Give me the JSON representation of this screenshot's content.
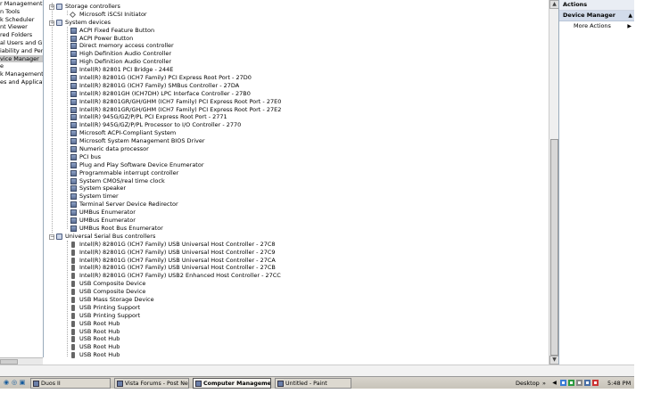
{
  "left_pane": {
    "items": [
      {
        "label": "r Management (L",
        "selected": false
      },
      {
        "label": "n Tools",
        "selected": false
      },
      {
        "label": "k Scheduler",
        "selected": false
      },
      {
        "label": "nt Viewer",
        "selected": false
      },
      {
        "label": "red Folders",
        "selected": false
      },
      {
        "label": "al Users and Gr",
        "selected": false
      },
      {
        "label": "iability and Perfc",
        "selected": false
      },
      {
        "label": "vice Manager",
        "selected": true
      },
      {
        "label": "e",
        "selected": false
      },
      {
        "label": "k Management",
        "selected": false
      },
      {
        "label": "es and Applicatio",
        "selected": false
      }
    ]
  },
  "tree": {
    "rows": [
      {
        "label": "Storage controllers",
        "level": 0,
        "kind": "category",
        "icon": "storage-controller-icon",
        "expanded": true
      },
      {
        "label": "Microsoft iSCSI Initiator",
        "level": 1,
        "kind": "device",
        "icon": "iscsi-icon"
      },
      {
        "label": "System devices",
        "level": 0,
        "kind": "category",
        "icon": "system-devices-icon",
        "expanded": true
      },
      {
        "label": "ACPI Fixed Feature Button",
        "level": 1,
        "kind": "device",
        "icon": "system-device-icon"
      },
      {
        "label": "ACPI Power Button",
        "level": 1,
        "kind": "device",
        "icon": "system-device-icon"
      },
      {
        "label": "Direct memory access controller",
        "level": 1,
        "kind": "device",
        "icon": "system-device-icon"
      },
      {
        "label": "High Definition Audio Controller",
        "level": 1,
        "kind": "device",
        "icon": "system-device-icon"
      },
      {
        "label": "High Definition Audio Controller",
        "level": 1,
        "kind": "device",
        "icon": "system-device-icon"
      },
      {
        "label": "Intel(R) 82801 PCI Bridge - 244E",
        "level": 1,
        "kind": "device",
        "icon": "system-device-icon"
      },
      {
        "label": "Intel(R) 82801G (ICH7 Family) PCI Express Root Port - 27D0",
        "level": 1,
        "kind": "device",
        "icon": "system-device-icon"
      },
      {
        "label": "Intel(R) 82801G (ICH7 Family) SMBus Controller - 27DA",
        "level": 1,
        "kind": "device",
        "icon": "system-device-icon"
      },
      {
        "label": "Intel(R) 82801GH (ICH7DH) LPC Interface Controller - 27B0",
        "level": 1,
        "kind": "device",
        "icon": "system-device-icon"
      },
      {
        "label": "Intel(R) 82801GR/GH/GHM (ICH7 Family) PCI Express Root Port - 27E0",
        "level": 1,
        "kind": "device",
        "icon": "system-device-icon"
      },
      {
        "label": "Intel(R) 82801GR/GH/GHM (ICH7 Family) PCI Express Root Port - 27E2",
        "level": 1,
        "kind": "device",
        "icon": "system-device-icon"
      },
      {
        "label": "Intel(R) 945G/GZ/P/PL PCI Express Root Port - 2771",
        "level": 1,
        "kind": "device",
        "icon": "system-device-icon"
      },
      {
        "label": "Intel(R) 945G/GZ/P/PL Processor to I/O Controller - 2770",
        "level": 1,
        "kind": "device",
        "icon": "system-device-icon"
      },
      {
        "label": "Microsoft ACPI-Compliant System",
        "level": 1,
        "kind": "device",
        "icon": "system-device-icon"
      },
      {
        "label": "Microsoft System Management BIOS Driver",
        "level": 1,
        "kind": "device",
        "icon": "system-device-icon"
      },
      {
        "label": "Numeric data processor",
        "level": 1,
        "kind": "device",
        "icon": "system-device-icon"
      },
      {
        "label": "PCI bus",
        "level": 1,
        "kind": "device",
        "icon": "system-device-icon"
      },
      {
        "label": "Plug and Play Software Device Enumerator",
        "level": 1,
        "kind": "device",
        "icon": "system-device-icon"
      },
      {
        "label": "Programmable interrupt controller",
        "level": 1,
        "kind": "device",
        "icon": "system-device-icon"
      },
      {
        "label": "System CMOS/real time clock",
        "level": 1,
        "kind": "device",
        "icon": "system-device-icon"
      },
      {
        "label": "System speaker",
        "level": 1,
        "kind": "device",
        "icon": "system-device-icon"
      },
      {
        "label": "System timer",
        "level": 1,
        "kind": "device",
        "icon": "system-device-icon"
      },
      {
        "label": "Terminal Server Device Redirector",
        "level": 1,
        "kind": "device",
        "icon": "system-device-icon"
      },
      {
        "label": "UMBus Enumerator",
        "level": 1,
        "kind": "device",
        "icon": "system-device-icon"
      },
      {
        "label": "UMBus Enumerator",
        "level": 1,
        "kind": "device",
        "icon": "system-device-icon"
      },
      {
        "label": "UMBus Root Bus Enumerator",
        "level": 1,
        "kind": "device",
        "icon": "system-device-icon"
      },
      {
        "label": "Universal Serial Bus controllers",
        "level": 0,
        "kind": "category",
        "icon": "usb-category-icon",
        "expanded": true
      },
      {
        "label": "Intel(R) 82801G (ICH7 Family) USB Universal Host Controller - 27C8",
        "level": 1,
        "kind": "device",
        "icon": "usb-icon"
      },
      {
        "label": "Intel(R) 82801G (ICH7 Family) USB Universal Host Controller - 27C9",
        "level": 1,
        "kind": "device",
        "icon": "usb-icon"
      },
      {
        "label": "Intel(R) 82801G (ICH7 Family) USB Universal Host Controller - 27CA",
        "level": 1,
        "kind": "device",
        "icon": "usb-icon"
      },
      {
        "label": "Intel(R) 82801G (ICH7 Family) USB Universal Host Controller - 27CB",
        "level": 1,
        "kind": "device",
        "icon": "usb-icon"
      },
      {
        "label": "Intel(R) 82801G (ICH7 Family) USB2 Enhanced Host Controller - 27CC",
        "level": 1,
        "kind": "device",
        "icon": "usb-icon"
      },
      {
        "label": "USB Composite Device",
        "level": 1,
        "kind": "device",
        "icon": "usb-icon"
      },
      {
        "label": "USB Composite Device",
        "level": 1,
        "kind": "device",
        "icon": "usb-icon"
      },
      {
        "label": "USB Mass Storage Device",
        "level": 1,
        "kind": "device",
        "icon": "usb-icon"
      },
      {
        "label": "USB Printing Support",
        "level": 1,
        "kind": "device",
        "icon": "usb-icon"
      },
      {
        "label": "USB Printing Support",
        "level": 1,
        "kind": "device",
        "icon": "usb-icon"
      },
      {
        "label": "USB Root Hub",
        "level": 1,
        "kind": "device",
        "icon": "usb-icon"
      },
      {
        "label": "USB Root Hub",
        "level": 1,
        "kind": "device",
        "icon": "usb-icon"
      },
      {
        "label": "USB Root Hub",
        "level": 1,
        "kind": "device",
        "icon": "usb-icon"
      },
      {
        "label": "USB Root Hub",
        "level": 1,
        "kind": "device",
        "icon": "usb-icon"
      },
      {
        "label": "USB Root Hub",
        "level": 1,
        "kind": "device",
        "icon": "usb-icon"
      }
    ]
  },
  "actions": {
    "header": "Actions",
    "section": "Device Manager",
    "more_actions": "More Actions"
  },
  "taskbar": {
    "buttons": [
      {
        "label": "Duos II",
        "active": false,
        "icon": "app-icon"
      },
      {
        "label": "Vista Forums - Post New...",
        "active": false,
        "icon": "browser-icon"
      },
      {
        "label": "Computer Management",
        "active": true,
        "icon": "computer-management-icon"
      },
      {
        "label": "Untitled - Paint",
        "active": false,
        "icon": "paint-icon"
      }
    ],
    "tray": {
      "desktop_label": "Desktop",
      "desktop_chevron": "»",
      "clock": "5:48 PM"
    }
  }
}
